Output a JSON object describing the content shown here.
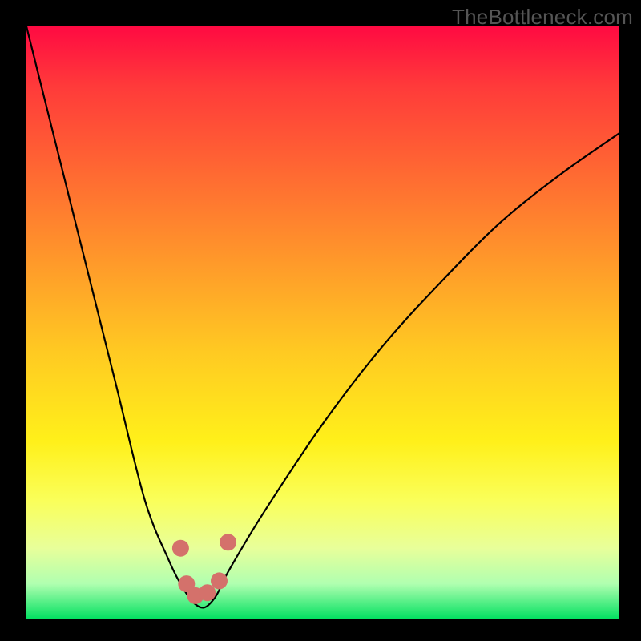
{
  "watermark": "TheBottleneck.com",
  "chart_data": {
    "type": "line",
    "title": "",
    "xlabel": "",
    "ylabel": "",
    "xlim": [
      0,
      100
    ],
    "ylim": [
      0,
      100
    ],
    "grid": false,
    "legend": false,
    "series": [
      {
        "name": "bottleneck-curve",
        "x": [
          0,
          5,
          10,
          15,
          20,
          24,
          26,
          28,
          30,
          32,
          34,
          40,
          50,
          60,
          70,
          80,
          90,
          100
        ],
        "y": [
          100,
          80,
          60,
          40,
          20,
          10,
          6,
          3,
          2,
          4,
          8,
          18,
          33,
          46,
          57,
          67,
          75,
          82
        ]
      }
    ],
    "markers": [
      {
        "name": "marker-a",
        "x": 26.0,
        "y": 12.0
      },
      {
        "name": "marker-b",
        "x": 27.0,
        "y": 6.0
      },
      {
        "name": "marker-c",
        "x": 28.5,
        "y": 4.0
      },
      {
        "name": "marker-d",
        "x": 30.5,
        "y": 4.5
      },
      {
        "name": "marker-e",
        "x": 32.5,
        "y": 6.5
      },
      {
        "name": "marker-f",
        "x": 34.0,
        "y": 13.0
      }
    ],
    "colors": {
      "curve": "#000000",
      "marker": "#d4716b",
      "gradient_top": "#ff0a42",
      "gradient_bottom": "#00e060"
    }
  }
}
